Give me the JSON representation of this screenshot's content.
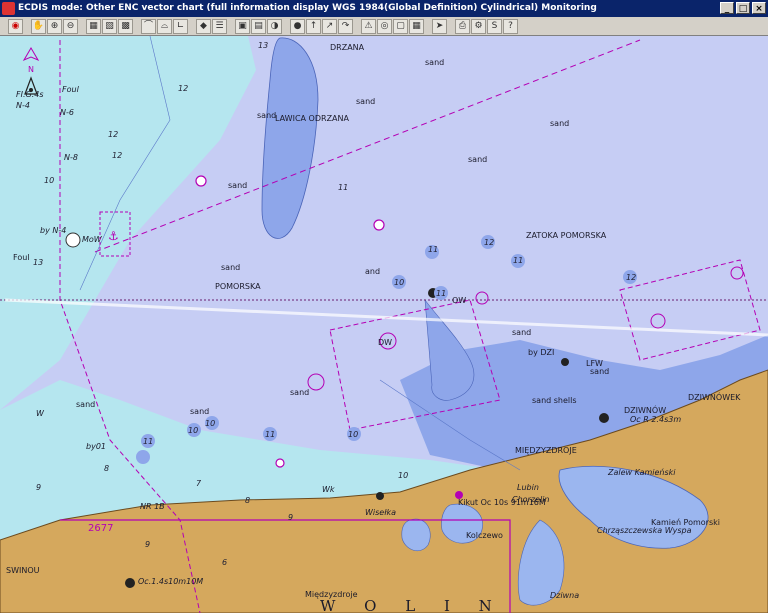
{
  "window": {
    "title": "ECDIS mode: Other ENC vector chart (full information display  WGS 1984(Global Definition)  Cylindrical)    Monitoring",
    "buttons": [
      "_",
      "□",
      "×"
    ]
  },
  "toolbar": {
    "buttons": [
      "stop",
      "zoom-in",
      "zoom-out",
      "pan",
      "layers",
      "route",
      "waypoint",
      "measure",
      "info",
      "display",
      "centre",
      "track",
      "alarm",
      "print",
      "script",
      "help"
    ]
  },
  "map": {
    "colors": {
      "deep_water": "#c6cdf4",
      "shallow_water": "#8ea6ea",
      "very_shallow": "#b5e6ef",
      "land": "#d5a85d",
      "land_outline": "#6b4a1e",
      "lake": "#9bb6ef"
    },
    "place_labels": {
      "lawica_odrzana": "LAWICA ODRZANA",
      "odrzana_top": "DRZANA",
      "zatoka_pomorska": "ZATOKA POMORSKA",
      "pomorska": "POMORSKA",
      "miedzyzdroje": "MIĘDZYZDROJE",
      "miedzyzdroje_town": "Międzyzdroje",
      "zalew_kamienski": "Zalew Kamieński",
      "kamien_pomorski": "Kamień Pomorski",
      "chrzaszczewska": "Chrząszczewska Wyspa",
      "dziwnow": "DZIWNÓW",
      "dziwnowek": "DZIWNÓWEK",
      "wolin": "W O L I N",
      "dziwna": "Dziwna",
      "lubin": "Lubin",
      "kolczewo": "Kolczewo",
      "ostrow": "Chorzelin",
      "mielno": "Wisełka"
    },
    "seabed_labels": {
      "sand": "sand",
      "sand_shells": "sand shells",
      "and": "and"
    },
    "light_labels": {
      "dziwnow_light": "Oc R 2.4s3m",
      "kikut": "Kikut Oc 10s 91m16M",
      "swinoujscie_light": "Oc.1.4s10m10M",
      "by_dzi": "by DZI",
      "lfw": "LFW",
      "foul_top": "FI.G.4s",
      "foul_lbl": "Foul",
      "n4": "N-4",
      "n6": "N-6",
      "n8": "N-8",
      "byn4": "by N-4",
      "mow": "MoW",
      "by01": "by01",
      "nr1b": "NR 1B",
      "w": "W",
      "wk": "Wk",
      "dw": "DW",
      "ow": "OW",
      "ld": "2677",
      "swinoujscie": "SWINOU"
    },
    "depths": [
      "13",
      "12",
      "11",
      "12",
      "11",
      "10",
      "11",
      "12",
      "10",
      "13",
      "12",
      "11",
      "10",
      "9",
      "11",
      "10",
      "10",
      "8",
      "7",
      "9",
      "12",
      "11",
      "6",
      "8",
      "9",
      "10"
    ]
  }
}
